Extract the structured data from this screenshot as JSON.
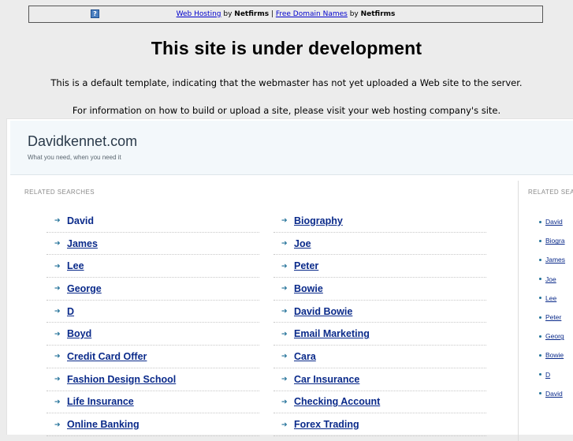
{
  "topbar": {
    "help_icon": "?",
    "link1": "Web Hosting",
    "by1": " by ",
    "brand1": "Netfirms",
    "sep": " | ",
    "link2": "Free Domain Names",
    "by2": " by ",
    "brand2": "Netfirms"
  },
  "notice": {
    "title": "This site is under development",
    "line1": "This is a default template, indicating that the webmaster has not yet uploaded a Web site to the server.",
    "line2": "For information on how to build or upload a site, please visit your web hosting company's site."
  },
  "site": {
    "name": "Davidkennet.com",
    "tagline": "What you need, when you need it"
  },
  "related": {
    "label": "RELATED SEARCHES",
    "label_right": "RELATED SEA",
    "left": [
      "David",
      "James",
      "Lee",
      "George",
      "D",
      "Boyd",
      "Credit Card Offer",
      "Fashion Design School",
      "Life Insurance",
      "Online Banking"
    ],
    "right": [
      "Biography",
      "Joe",
      "Peter",
      "Bowie",
      "David Bowie",
      "Email Marketing",
      "Cara",
      "Car Insurance",
      "Checking Account",
      "Forex Trading"
    ]
  },
  "sidebar": {
    "items": [
      "David",
      "Biogra",
      "James",
      "Joe",
      "Lee",
      "Peter",
      "Georg",
      "Bowie",
      "D",
      "David"
    ]
  },
  "icons": {
    "arrow": "right-arrow-icon",
    "bullet": "bullet-icon",
    "help": "help-icon"
  },
  "colors": {
    "link": "#0a2a8a",
    "accent": "#1f6f97",
    "header_bg": "#f3f8fb"
  }
}
